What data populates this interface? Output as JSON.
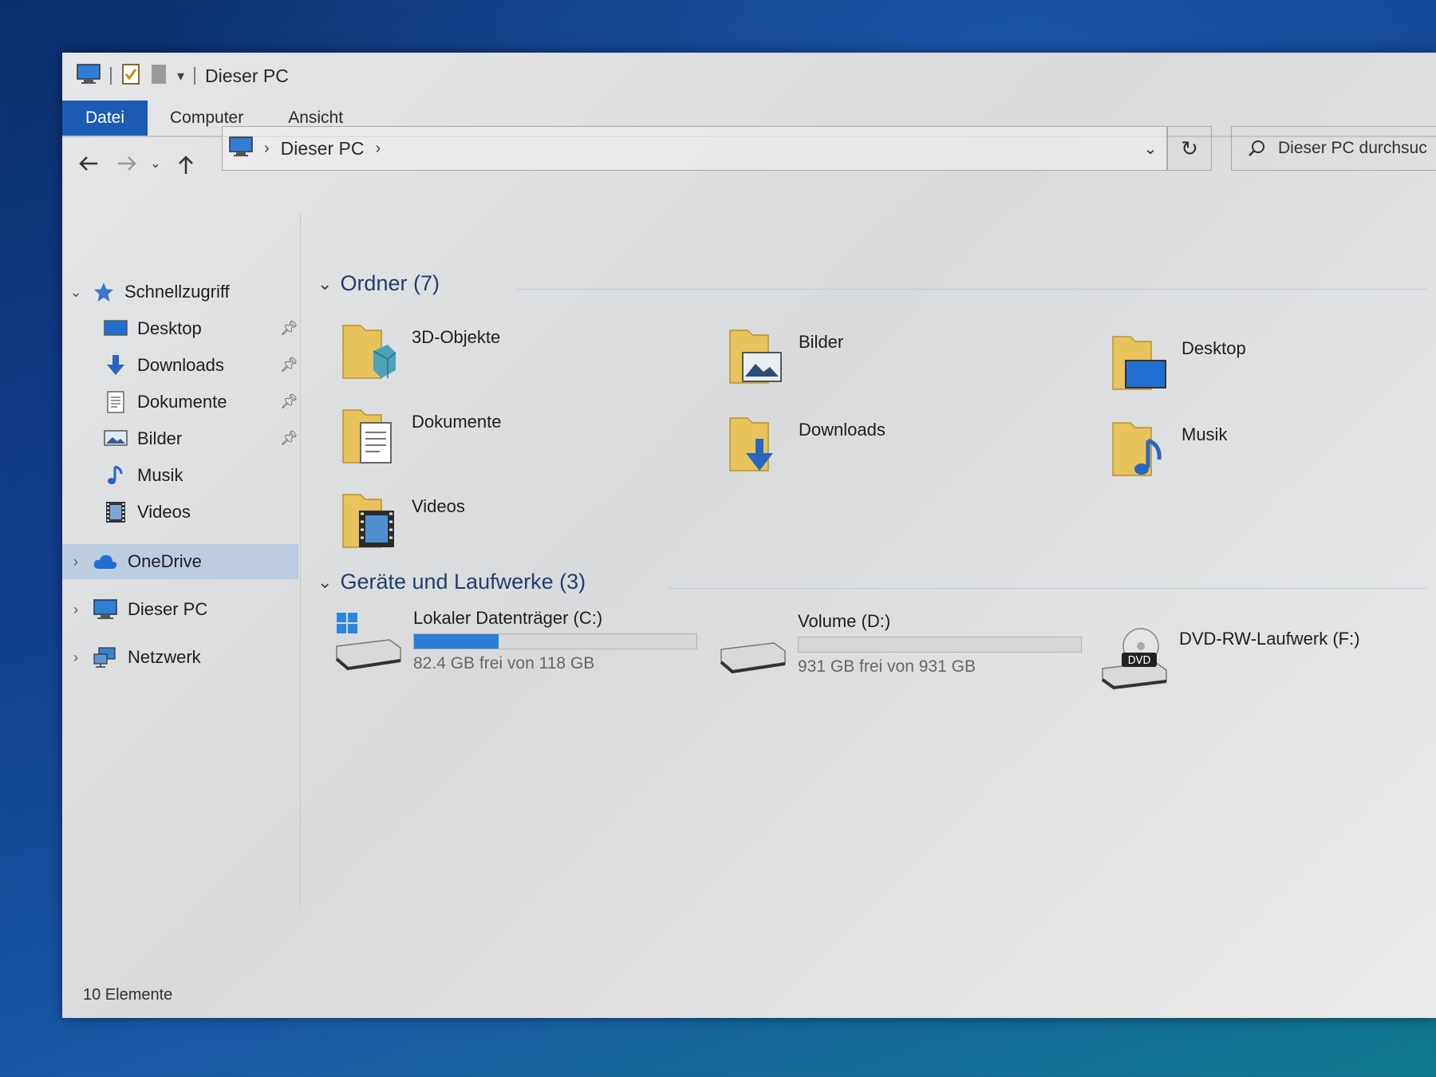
{
  "window": {
    "title": "Dieser PC"
  },
  "ribbon": {
    "tabs": [
      "Datei",
      "Computer",
      "Ansicht"
    ]
  },
  "address": {
    "crumbs": [
      "Dieser PC"
    ],
    "search_placeholder": "Dieser PC durchsuc"
  },
  "sidebar": {
    "quick_access": "Schnellzugriff",
    "quick_items": [
      {
        "label": "Desktop",
        "icon": "desktop-icon",
        "pinned": true
      },
      {
        "label": "Downloads",
        "icon": "download-arrow-icon",
        "pinned": true
      },
      {
        "label": "Dokumente",
        "icon": "document-icon",
        "pinned": true
      },
      {
        "label": "Bilder",
        "icon": "picture-icon",
        "pinned": true
      },
      {
        "label": "Musik",
        "icon": "music-note-icon",
        "pinned": false
      },
      {
        "label": "Videos",
        "icon": "film-icon",
        "pinned": false
      }
    ],
    "onedrive": "OneDrive",
    "this_pc": "Dieser PC",
    "network": "Netzwerk",
    "selected": "Dieser PC"
  },
  "groups": {
    "folders_header": "Ordner (7)",
    "folders": [
      {
        "label": "3D-Objekte",
        "icon": "cube-icon"
      },
      {
        "label": "Bilder",
        "icon": "picture-icon"
      },
      {
        "label": "Desktop",
        "icon": "desktop-icon"
      },
      {
        "label": "Dokumente",
        "icon": "document-icon"
      },
      {
        "label": "Downloads",
        "icon": "download-arrow-icon"
      },
      {
        "label": "Musik",
        "icon": "music-note-icon"
      },
      {
        "label": "Videos",
        "icon": "film-icon"
      }
    ],
    "drives_header": "Geräte und Laufwerke (3)",
    "drives": [
      {
        "name": "Lokaler Datenträger (C:)",
        "free": "82.4 GB frei von 118 GB",
        "used_fraction": 0.3,
        "icon": "windows-drive-icon"
      },
      {
        "name": "Volume (D:)",
        "free": "931 GB frei von 931 GB",
        "used_fraction": 0.0,
        "icon": "hard-drive-icon"
      },
      {
        "name": "DVD-RW-Laufwerk (F:)",
        "icon": "dvd-drive-icon",
        "badge": "DVD"
      }
    ]
  },
  "status": {
    "count": "10 Elemente"
  },
  "colors": {
    "accent": "#1c5bb4",
    "bar_fill": "#2b7dd6",
    "folder": "#e8c25a"
  }
}
